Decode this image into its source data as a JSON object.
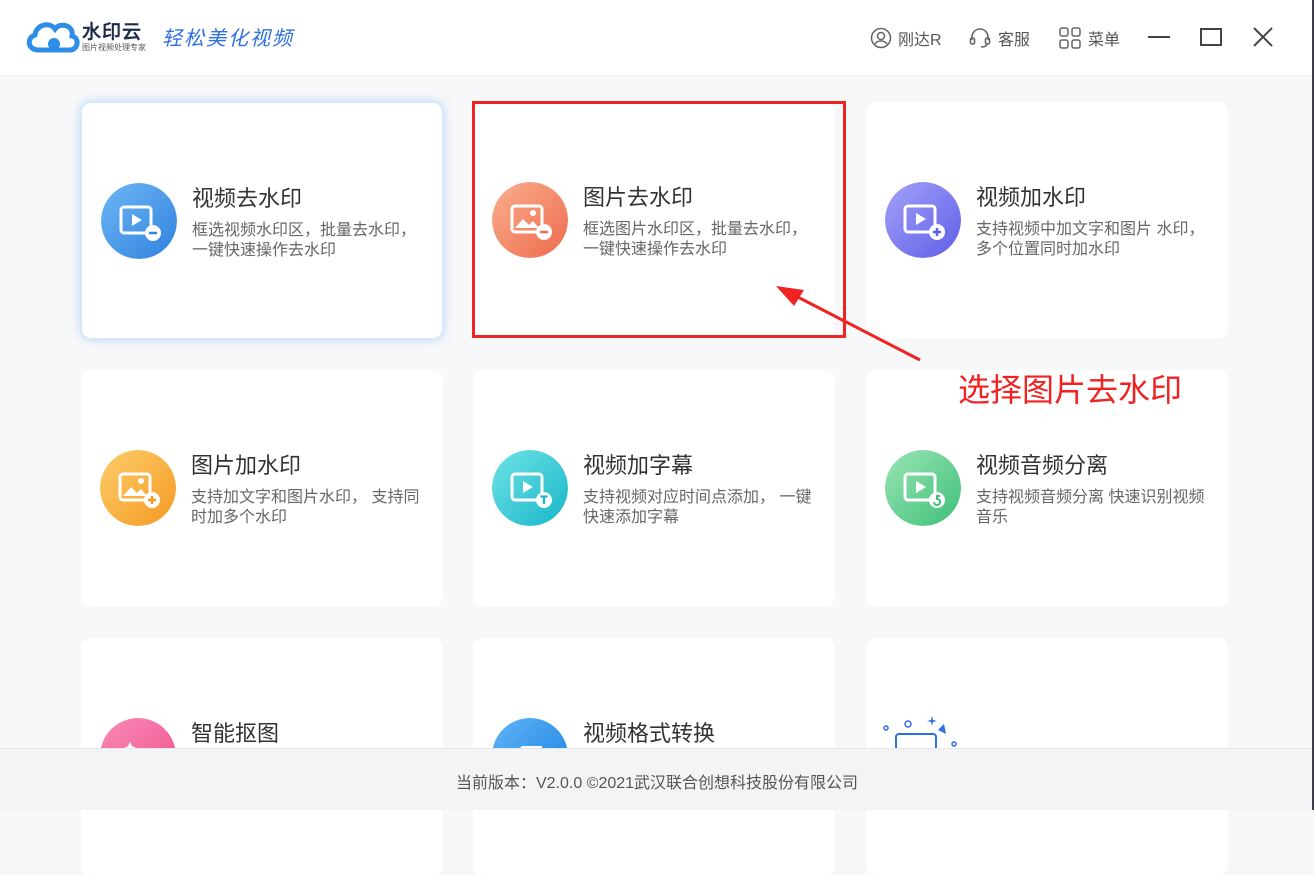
{
  "header": {
    "brand": "水印云",
    "brand_sub": "图片视频处理专家",
    "slogan": "轻松美化视频",
    "user": "刚达R",
    "service": "客服",
    "menu": "菜单"
  },
  "cards": [
    {
      "title": "视频去水印",
      "desc": "框选视频水印区，批量去水印， 一键快速操作去水印",
      "icon": "video-remove-icon",
      "color": "#4a9be8"
    },
    {
      "title": "图片去水印",
      "desc": "框选图片水印区，批量去水印， 一键快速操作去水印",
      "icon": "image-remove-icon",
      "color": "#f48a6a"
    },
    {
      "title": "视频加水印",
      "desc": "支持视频中加文字和图片 水印，多个位置同时加水印",
      "icon": "video-add-icon",
      "color": "#7f7ef0"
    },
    {
      "title": "图片加水印",
      "desc": "支持加文字和图片水印， 支持同时加多个水印",
      "icon": "image-add-icon",
      "color": "#f9ad3d"
    },
    {
      "title": "视频加字幕",
      "desc": "支持视频对应时间点添加， 一键快速添加字幕",
      "icon": "video-subtitle-icon",
      "color": "#3ccfd6"
    },
    {
      "title": "视频音频分离",
      "desc": "支持视频音频分离 快速识别视频音乐",
      "icon": "audio-separate-icon",
      "color": "#6cd39a"
    },
    {
      "title": "智能抠图",
      "desc": "",
      "icon": "smart-cutout-icon",
      "color": "#f35f9a"
    },
    {
      "title": "视频格式转换",
      "desc": "",
      "icon": "format-convert-icon",
      "color": "#2a8fe8"
    },
    {
      "title": "",
      "desc": "",
      "icon": "more-tools-icon",
      "color": "#2f6fe0"
    }
  ],
  "annotation": {
    "text": "选择图片去水印",
    "color": "#f02222"
  },
  "footer": {
    "version_text": "当前版本：V2.0.0 ©2021武汉联合创想科技股份有限公司"
  }
}
